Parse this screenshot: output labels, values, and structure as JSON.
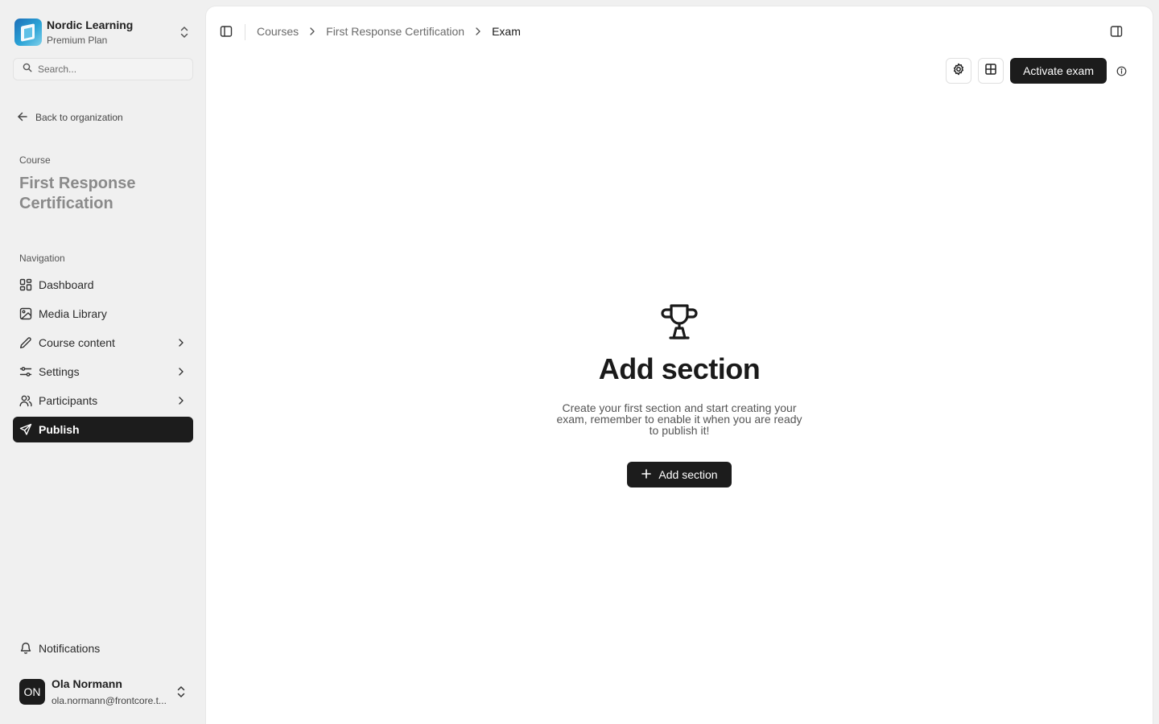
{
  "organization": {
    "name": "Nordic Learning",
    "plan": "Premium Plan"
  },
  "search": {
    "placeholder": "Search..."
  },
  "back_link": "Back to organization",
  "course": {
    "caption": "Course",
    "title": "First Response Certification"
  },
  "navigation": {
    "caption": "Navigation",
    "items": [
      {
        "label": "Dashboard",
        "icon": "dashboard-icon"
      },
      {
        "label": "Media Library",
        "icon": "image-icon"
      },
      {
        "label": "Course content",
        "icon": "pencil-icon",
        "expandable": true
      },
      {
        "label": "Settings",
        "icon": "sliders-icon",
        "expandable": true
      },
      {
        "label": "Participants",
        "icon": "users-icon",
        "expandable": true
      },
      {
        "label": "Publish",
        "icon": "send-icon",
        "active": true
      }
    ]
  },
  "notifications": {
    "label": "Notifications"
  },
  "user": {
    "initials": "ON",
    "name": "Ola Normann",
    "email": "ola.normann@frontcore.t..."
  },
  "breadcrumb": [
    "Courses",
    "First Response Certification",
    "Exam"
  ],
  "toolbar": {
    "activate_label": "Activate exam"
  },
  "empty_state": {
    "title": "Add section",
    "description": "Create your first section and start creating your exam, remember to enable it when you are ready to publish it!",
    "button_label": "Add section"
  },
  "colors": {
    "active_nav_bg": "#1c1c1c",
    "primary_button": "#1c1c1c",
    "sidebar_bg": "#f0f0f0"
  }
}
